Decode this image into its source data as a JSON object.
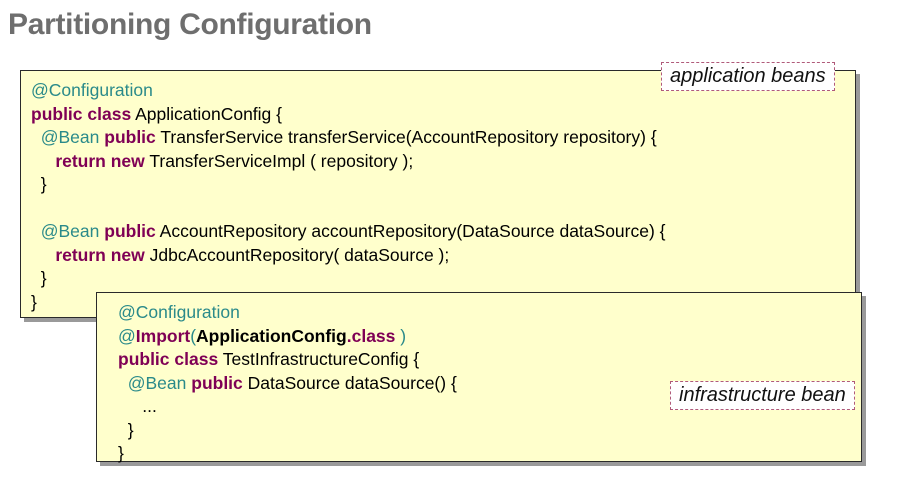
{
  "title": "Partitioning Configuration",
  "box1": {
    "label": "application beans",
    "lines": [
      [
        {
          "c": "ann",
          "t": "@Configuration"
        }
      ],
      [
        {
          "c": "kw",
          "t": "public class"
        },
        {
          "c": "",
          "t": " ApplicationConfig {"
        }
      ],
      [
        {
          "c": "",
          "t": "  "
        },
        {
          "c": "ann",
          "t": "@Bean"
        },
        {
          "c": "",
          "t": " "
        },
        {
          "c": "kw",
          "t": "public"
        },
        {
          "c": "",
          "t": " TransferService transferService(AccountRepository repository) {"
        }
      ],
      [
        {
          "c": "",
          "t": "     "
        },
        {
          "c": "kw",
          "t": "return new"
        },
        {
          "c": "",
          "t": " TransferServiceImpl ( repository );"
        }
      ],
      [
        {
          "c": "",
          "t": "  }"
        }
      ],
      [
        {
          "c": "",
          "t": ""
        }
      ],
      [
        {
          "c": "",
          "t": "  "
        },
        {
          "c": "ann",
          "t": "@Bean"
        },
        {
          "c": "",
          "t": " "
        },
        {
          "c": "kw",
          "t": "public"
        },
        {
          "c": "",
          "t": " AccountRepository accountRepository(DataSource dataSource) {"
        }
      ],
      [
        {
          "c": "",
          "t": "     "
        },
        {
          "c": "kw",
          "t": "return new"
        },
        {
          "c": "",
          "t": " JdbcAccountRepository( dataSource );"
        }
      ],
      [
        {
          "c": "",
          "t": "  }"
        }
      ],
      [
        {
          "c": "",
          "t": "}"
        }
      ]
    ]
  },
  "box2": {
    "label": "infrastructure bean",
    "lines": [
      [
        {
          "c": "ann",
          "t": "@Configuration"
        }
      ],
      [
        {
          "c": "ann",
          "t": "@"
        },
        {
          "c": "kw",
          "t": "Import"
        },
        {
          "c": "ann",
          "t": "("
        },
        {
          "c": "bold",
          "t": "ApplicationConfig"
        },
        {
          "c": "kw",
          "t": ".class"
        },
        {
          "c": "ann",
          "t": " )"
        }
      ],
      [
        {
          "c": "kw",
          "t": "public class"
        },
        {
          "c": "",
          "t": " TestInfrastructureConfig {"
        }
      ],
      [
        {
          "c": "",
          "t": "  "
        },
        {
          "c": "ann",
          "t": "@Bean"
        },
        {
          "c": "",
          "t": " "
        },
        {
          "c": "kw",
          "t": "public"
        },
        {
          "c": "",
          "t": " DataSource dataSource() {"
        }
      ],
      [
        {
          "c": "",
          "t": "     ..."
        }
      ],
      [
        {
          "c": "",
          "t": "  }"
        }
      ],
      [
        {
          "c": "",
          "t": "}"
        }
      ]
    ]
  }
}
